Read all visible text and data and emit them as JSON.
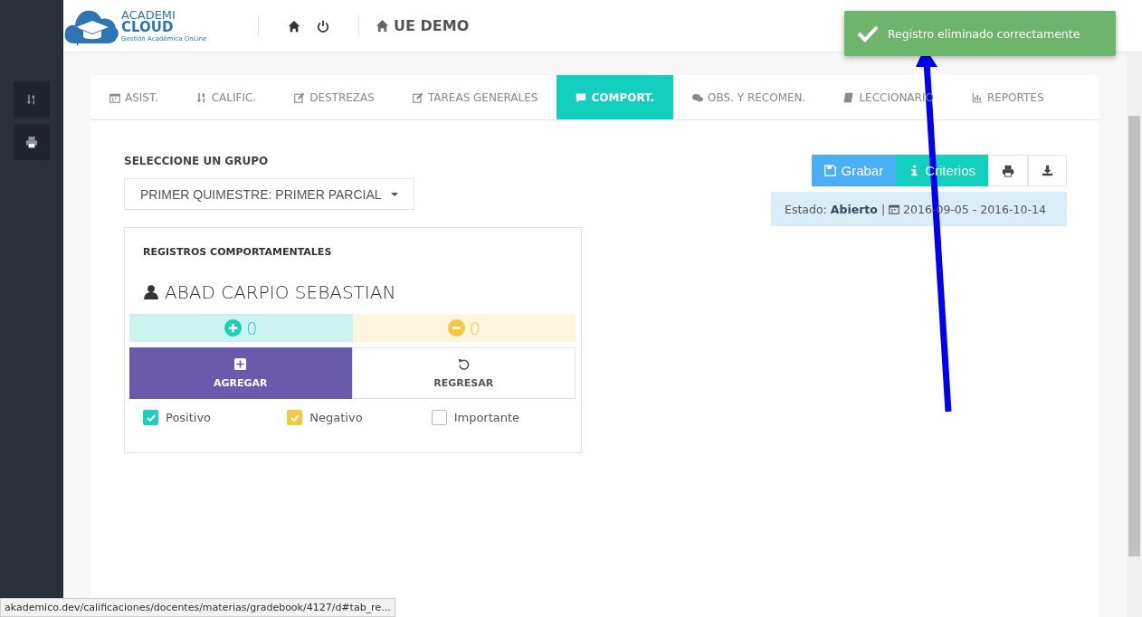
{
  "logo": {
    "line1": "ACADEMI",
    "line2": "CLOUD",
    "tagline": "Gestión Académica OnLine"
  },
  "header": {
    "school": "UE DEMO"
  },
  "sidebar": {
    "buttons": [
      {
        "kind": "sort"
      },
      {
        "kind": "print"
      }
    ]
  },
  "toast": {
    "message": "Registro eliminado correctamente"
  },
  "tabs": [
    {
      "label": "ASIST.",
      "kind": "calendar",
      "selected": false
    },
    {
      "label": "CALIFIC.",
      "kind": "sort",
      "selected": false
    },
    {
      "label": "DESTREZAS",
      "kind": "edit",
      "selected": false
    },
    {
      "label": "TAREAS GENERALES",
      "kind": "edit",
      "selected": false
    },
    {
      "label": "COMPORT.",
      "kind": "comment",
      "selected": true
    },
    {
      "label": "OBS. Y RECOMEN.",
      "kind": "comments",
      "selected": false
    },
    {
      "label": "LECCIONARIO",
      "kind": "book",
      "selected": false
    },
    {
      "label": "REPORTES",
      "kind": "chart",
      "selected": false
    }
  ],
  "group": {
    "label": "SELECCIONE UN GRUPO",
    "value": "PRIMER QUIMESTRE: PRIMER PARCIAL"
  },
  "actions": {
    "save": "Grabar",
    "criteria": "Criterios"
  },
  "status": {
    "label": "Estado:",
    "value": "Abierto",
    "separator": "|",
    "dates": "2016-09-05 - 2016-10-14"
  },
  "records": {
    "title": "REGISTROS COMPORTAMENTALES",
    "student": "ABAD CARPIO SEBASTIAN",
    "positive_count": "0",
    "negative_count": "0",
    "add": "AGREGAR",
    "back": "REGRESAR",
    "options": [
      {
        "label": "Positivo",
        "checked": true,
        "color": "#1ccfb9"
      },
      {
        "label": "Negativo",
        "checked": true,
        "color": "#f5c842"
      },
      {
        "label": "Importante",
        "checked": false
      }
    ]
  },
  "status_bar": {
    "url": "akademico.dev/calificaciones/docentes/materias/gradebook/4127/d#tab_re..."
  }
}
